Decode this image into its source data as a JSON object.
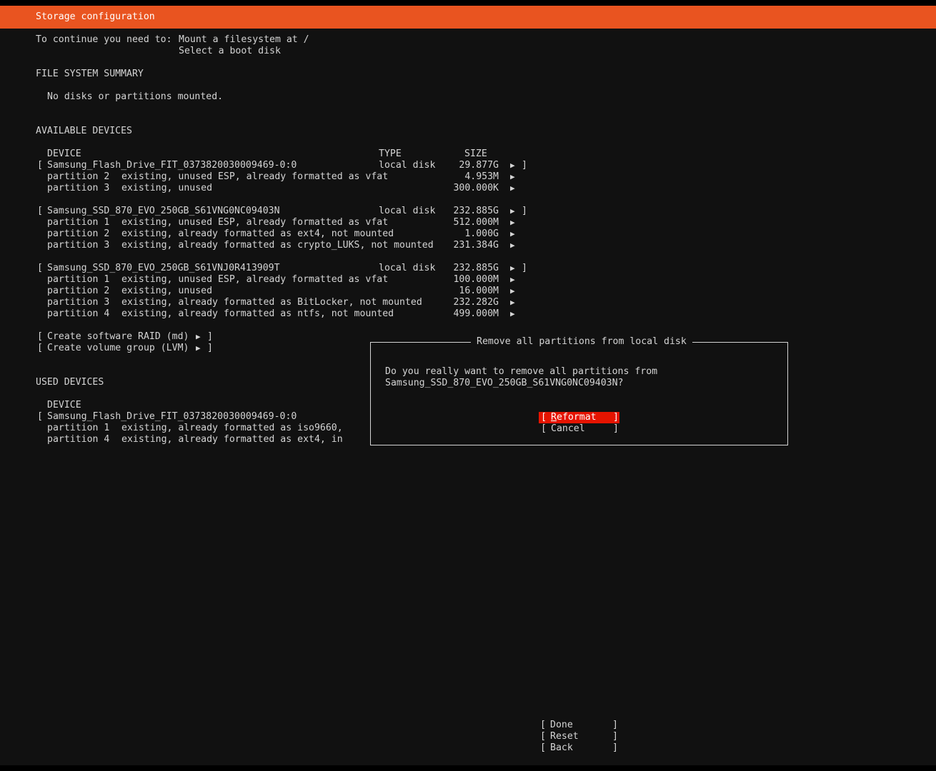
{
  "header": {
    "title": "Storage configuration"
  },
  "todo": {
    "prefix": "To continue you need to:",
    "items": [
      "Mount a filesystem at /",
      "Select a boot disk"
    ]
  },
  "fs_summary": {
    "heading": "FILE SYSTEM SUMMARY",
    "empty_text": "No disks or partitions mounted."
  },
  "available": {
    "heading": "AVAILABLE DEVICES",
    "col_device": "DEVICE",
    "col_type": "TYPE",
    "col_size": "SIZE",
    "disks": [
      {
        "name": "Samsung_Flash_Drive_FIT_0373820030009469-0:0",
        "type": "local disk",
        "size": "29.877G",
        "partitions": [
          {
            "label": "partition 2",
            "desc": "existing, unused ESP, already formatted as vfat",
            "size": "4.953M"
          },
          {
            "label": "partition 3",
            "desc": "existing, unused",
            "size": "300.000K"
          }
        ]
      },
      {
        "name": "Samsung_SSD_870_EVO_250GB_S61VNG0NC09403N",
        "type": "local disk",
        "size": "232.885G",
        "partitions": [
          {
            "label": "partition 1",
            "desc": "existing, unused ESP, already formatted as vfat",
            "size": "512.000M"
          },
          {
            "label": "partition 2",
            "desc": "existing, already formatted as ext4, not mounted",
            "size": "1.000G"
          },
          {
            "label": "partition 3",
            "desc": "existing, already formatted as crypto_LUKS, not mounted",
            "size": "231.384G"
          }
        ]
      },
      {
        "name": "Samsung_SSD_870_EVO_250GB_S61VNJ0R413909T",
        "type": "local disk",
        "size": "232.885G",
        "partitions": [
          {
            "label": "partition 1",
            "desc": "existing, unused ESP, already formatted as vfat",
            "size": "100.000M"
          },
          {
            "label": "partition 2",
            "desc": "existing, unused",
            "size": "16.000M"
          },
          {
            "label": "partition 3",
            "desc": "existing, already formatted as BitLocker, not mounted",
            "size": "232.282G"
          },
          {
            "label": "partition 4",
            "desc": "existing, already formatted as ntfs, not mounted",
            "size": "499.000M"
          }
        ]
      }
    ],
    "actions": [
      "Create software RAID (md)",
      "Create volume group (LVM)"
    ]
  },
  "used": {
    "heading": "USED DEVICES",
    "col_device": "DEVICE",
    "disk": "Samsung_Flash_Drive_FIT_0373820030009469-0:0",
    "partitions": [
      {
        "label": "partition 1",
        "desc": "existing, already formatted as iso9660,"
      },
      {
        "label": "partition 4",
        "desc": "existing, already formatted as ext4, in"
      }
    ]
  },
  "dialog": {
    "title": "Remove all partitions from local disk",
    "message_line1": "Do you really want to remove all partitions from",
    "message_line2": "Samsung_SSD_870_EVO_250GB_S61VNG0NC09403N?",
    "confirm_hotkey": "R",
    "confirm_rest": "eformat",
    "cancel": "Cancel"
  },
  "footer": {
    "buttons": [
      "Done",
      "Reset",
      "Back"
    ]
  },
  "glyphs": {
    "expand": "▶",
    "open": "[",
    "close": "]"
  },
  "colors": {
    "accent": "#e95420",
    "focus": "#e51400",
    "background": "#111111",
    "text": "#d4d4d4"
  }
}
